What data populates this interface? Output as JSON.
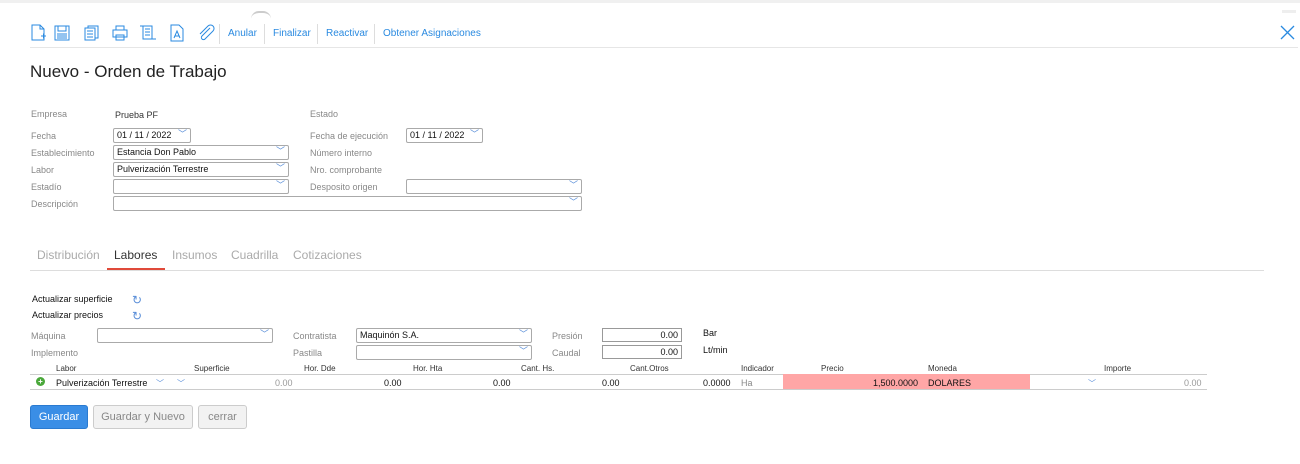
{
  "toolbar": {
    "links": [
      "Anular",
      "Finalizar",
      "Reactivar",
      "Obtener Asignaciones"
    ]
  },
  "title": "Nuevo - Orden de Trabajo",
  "form": {
    "empresa_label": "Empresa",
    "empresa_value": "Prueba PF",
    "estado_label": "Estado",
    "fecha_label": "Fecha",
    "fecha_value": "01 / 11 /  2022",
    "fecha_ejec_label": "Fecha de ejecución",
    "fecha_ejec_value": "01 / 11 /  2022",
    "establecimiento_label": "Establecimiento",
    "establecimiento_value": "Estancia Don Pablo",
    "numero_interno_label": "Número interno",
    "labor_label": "Labor",
    "labor_value": "Pulverización Terrestre",
    "nro_comprobante_label": "Nro. comprobante",
    "estadio_label": "Estadío",
    "estadio_value": "",
    "deposito_label": "Desposito origen",
    "deposito_value": "",
    "descripcion_label": "Descripción",
    "descripcion_value": ""
  },
  "tabs": [
    "Distribución",
    "Labores",
    "Insumos",
    "Cuadrilla",
    "Cotizaciones"
  ],
  "labores": {
    "actualizar_superficie": "Actualizar superficie",
    "actualizar_precios": "Actualizar precios",
    "maquina_label": "Máquina",
    "maquina_value": "",
    "implemento_label": "Implemento",
    "contratista_label": "Contratista",
    "contratista_value": "Maquinón S.A.",
    "pastilla_label": "Pastilla",
    "pastilla_value": "",
    "presion_label": "Presión",
    "presion_value": "0.00",
    "presion_unit": "Bar",
    "caudal_label": "Caudal",
    "caudal_value": "0.00",
    "caudal_unit": "Lt/min",
    "headers": [
      "Labor",
      "Superficie",
      "Hor. Dde",
      "Hor. Hta",
      "Cant. Hs.",
      "Cant.Otros",
      "Indicador",
      "Precio",
      "Moneda",
      "Importe"
    ],
    "row": {
      "labor": "Pulverización Terrestre",
      "superficie": "0.00",
      "hor_dde": "0.00",
      "hor_hta": "0.00",
      "cant_hs": "0.00",
      "cant_otros": "0.0000",
      "indicador": "Ha",
      "precio": "1,500.0000",
      "moneda": "DOLARES",
      "importe": "0.00"
    }
  },
  "buttons": {
    "guardar": "Guardar",
    "guardar_nuevo": "Guardar y Nuevo",
    "cerrar": "cerrar"
  },
  "colors": {
    "accent": "#2a8ae0",
    "highlight": "#ffa6a6",
    "tab_active": "#e04a3a"
  }
}
